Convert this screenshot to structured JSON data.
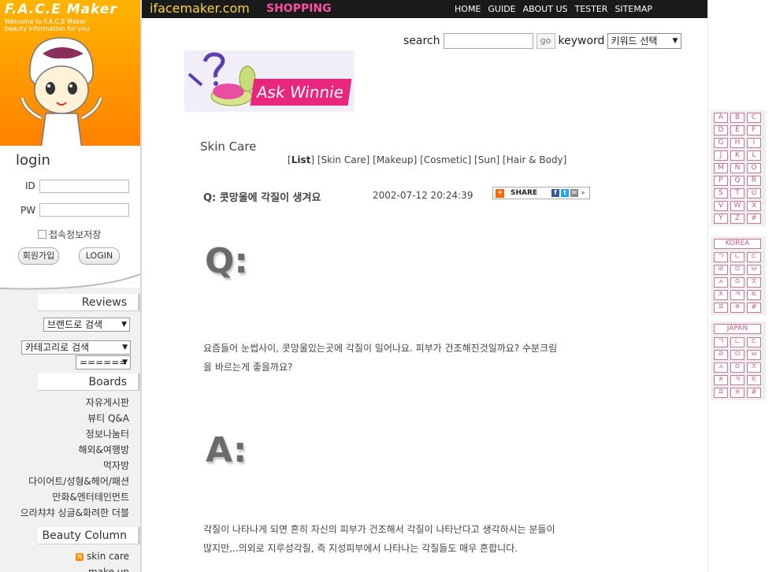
{
  "brand": {
    "title": "F.A.C.E Maker",
    "subtitle": "Welcome to F.A.C.E Maker beauty information for you"
  },
  "login": {
    "title": "login",
    "id_label": "ID",
    "pw_label": "PW",
    "save_label": "접속정보저장",
    "join_label": "회원가입",
    "login_label": "LOGIN"
  },
  "sidebar": {
    "reviews_title": "Reviews",
    "brand_search": "브랜드로 검색",
    "category_search": "카테고리로 검색",
    "sub_select": "======",
    "boards_title": "Boards",
    "boards": [
      "자유게시판",
      "뷰티 Q&A",
      "정보나눔터",
      "해외&여행방",
      "먹자방",
      "다이어트/성형&헤어/패션",
      "만화&엔터테인먼트",
      "으라챠챠 싱글&화려한 더블"
    ],
    "column_title": "Beauty Column",
    "column_items": [
      "skin care",
      "make up"
    ]
  },
  "topbar": {
    "site": "ifacemaker.com",
    "shop": "SHOPPING",
    "nav": [
      "HOME",
      "GUIDE",
      "ABOUT US",
      "TESTER",
      "SITEMAP"
    ]
  },
  "search": {
    "label": "search",
    "go": "go",
    "keyword_label": "keyword",
    "keyword_value": "키워드 선택"
  },
  "ask_logo": {
    "text": "Ask Winnie"
  },
  "category": {
    "title": "Skin Care",
    "current": "List",
    "links": [
      "Skin Care",
      "Makeup",
      "Cosmetic",
      "Sun",
      "Hair & Body"
    ]
  },
  "question": {
    "prefix": "Q:",
    "title": "콧망울에 각질이 생겨요",
    "date": "2002-07-12 20:24:39",
    "share": "SHARE"
  },
  "q_big": "Q:",
  "a_big": "A:",
  "question_body": "요즘들어 눈썹사이, 콧망울있는곳에 각질이 일어나요. 피부가 건조해진것일까요? 수분크림을 바르는게 좋을까요?",
  "answer_body": "각질이 나타나게 되면 흔히 자신의 피부가 건조해서 각질이 나타난다고 생각하시는 분들이 많지만,..의외로 지루성각질, 즉 지성피부에서 나타나는 각질들도 매우 흔합니다.",
  "index": {
    "latin": [
      "A",
      "B",
      "C",
      "D",
      "E",
      "F",
      "G",
      "H",
      "I",
      "J",
      "K",
      "L",
      "M",
      "N",
      "O",
      "P",
      "Q",
      "R",
      "S",
      "T",
      "U",
      "V",
      "W",
      "X",
      "Y",
      "Z",
      "#"
    ],
    "korea_label": "KOREA",
    "korea": [
      "ㄱ",
      "ㄴ",
      "ㄷ",
      "ㄹ",
      "ㅁ",
      "ㅂ",
      "ㅅ",
      "ㅇ",
      "ㅈ",
      "ㅊ",
      "ㅋ",
      "ㅌ",
      "ㅍ",
      "ㅎ",
      "#"
    ],
    "japan_label": "JAPAN",
    "japan": [
      "ㄱ",
      "ㄴ",
      "ㄷ",
      "ㄹ",
      "ㅁ",
      "ㅂ",
      "ㅅ",
      "ㅇ",
      "ㅈ",
      "ㅊ",
      "ㅋ",
      "ㅌ",
      "ㅍ",
      "ㅎ",
      "#"
    ]
  },
  "colors": {
    "accent_orange": "#ff9600",
    "pink": "#ff4fa4",
    "index_pink": "#c05f88"
  }
}
